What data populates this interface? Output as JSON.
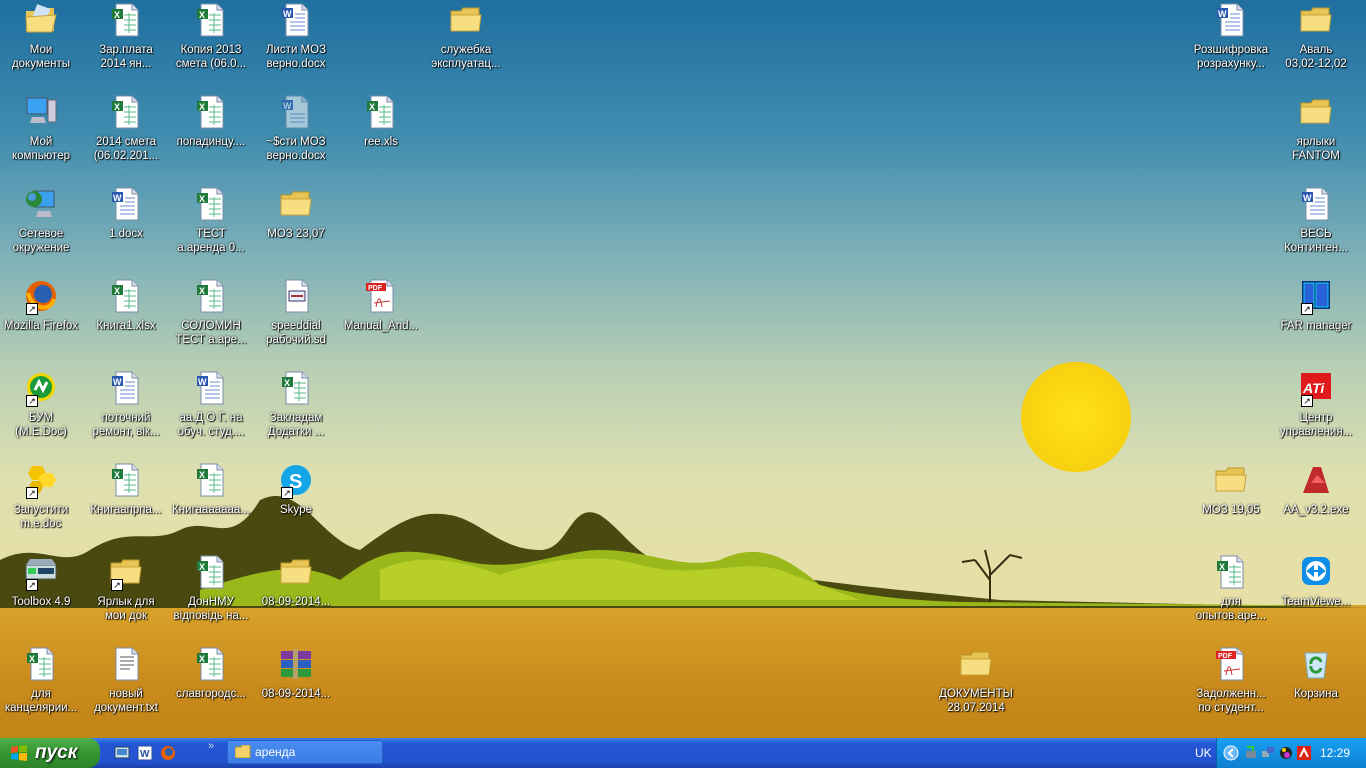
{
  "desktop": {
    "icons": [
      {
        "type": "mydocs",
        "label": "Мои\nдокументы"
      },
      {
        "type": "excel",
        "label": "Зар.плата\n2014 ян..."
      },
      {
        "type": "excel",
        "label": "Копия 2013\nсмета (06.0..."
      },
      {
        "type": "word",
        "label": "Листи МОЗ\nверно.docx"
      },
      {
        "type": "folder",
        "label": "служебка\nэксплуатац..."
      },
      {
        "type": "word",
        "label": "Розшифровка\nрозрахунку..."
      },
      {
        "type": "folder",
        "label": "Аваль\n03,02-12,02"
      },
      {
        "type": "computer",
        "label": "Мой\nкомпьютер"
      },
      {
        "type": "excel",
        "label": "2014 смета\n(06.02.201..."
      },
      {
        "type": "excel",
        "label": "попадинцу...."
      },
      {
        "type": "word-ghost",
        "label": "~$сти МОЗ\nверно.docx"
      },
      {
        "type": "excel",
        "label": "ree.xls"
      },
      {
        "type": "folder",
        "label": "ярлыки\nFANTOM"
      },
      {
        "type": "network",
        "label": "Сетевое\nокружение"
      },
      {
        "type": "word",
        "label": "1.docx"
      },
      {
        "type": "excel",
        "label": "ТЕСТ\nа.аренда 0..."
      },
      {
        "type": "folder",
        "label": "МОЗ 23,07"
      },
      {
        "type": "word",
        "label": "ВЕСЬ\nКонтинген..."
      },
      {
        "type": "firefox",
        "label": "Mozilla Firefox",
        "shortcut": true
      },
      {
        "type": "excel",
        "label": "Книга1.xlsx"
      },
      {
        "type": "excel",
        "label": "СОЛОМИН\nТЕСТ а.аре..."
      },
      {
        "type": "sd",
        "label": "speeddial\nрабочий.sd"
      },
      {
        "type": "pdf",
        "label": "Manual_And..."
      },
      {
        "type": "far",
        "label": "FAR manager",
        "shortcut": true
      },
      {
        "type": "medoc",
        "label": "БУМ\n(M.E.Doc)",
        "shortcut": true
      },
      {
        "type": "word",
        "label": "поточний\nремонт, вік..."
      },
      {
        "type": "word",
        "label": "аа.Д О Г. на\nобуч. студ...."
      },
      {
        "type": "excel",
        "label": "Закладам\nДодатки ..."
      },
      {
        "type": "ati",
        "label": "Центр\nуправления...",
        "shortcut": true
      },
      {
        "type": "medoc-run",
        "label": "Запустити\nm.e.doc",
        "shortcut": true
      },
      {
        "type": "excel",
        "label": "Книгаапрпа..."
      },
      {
        "type": "excel",
        "label": "Книгааааааа..."
      },
      {
        "type": "skype",
        "label": "Skype",
        "shortcut": true
      },
      {
        "type": "folder",
        "label": "МОЗ 19,05"
      },
      {
        "type": "aa",
        "label": "AA_v3.2.exe"
      },
      {
        "type": "toolbox",
        "label": "Toolbox 4.9",
        "shortcut": true
      },
      {
        "type": "folder",
        "label": "Ярлык для\nмои док",
        "shortcut": true
      },
      {
        "type": "excel",
        "label": "ДонНМУ\nвідповідь на..."
      },
      {
        "type": "folder",
        "label": "08-09-2014..."
      },
      {
        "type": "excel",
        "label": "для\nопытов.аре..."
      },
      {
        "type": "teamviewer",
        "label": "TeamViewe..."
      },
      {
        "type": "excel",
        "label": "для\nканцелярии..."
      },
      {
        "type": "txt",
        "label": "новый\nдокумент.txt"
      },
      {
        "type": "excel",
        "label": "славгородс..."
      },
      {
        "type": "rar",
        "label": "08-09-2014..."
      },
      {
        "type": "folder",
        "label": "ДОКУМЕНТЫ\n28.07.2014"
      },
      {
        "type": "pdf",
        "label": "Задолженн...\nпо студент..."
      },
      {
        "type": "recycle",
        "label": "Корзина"
      }
    ]
  },
  "taskbar": {
    "start_label": "пуск",
    "quick_launch": [
      "show-desktop-icon",
      "word-icon",
      "firefox-icon"
    ],
    "overflow": "»",
    "window_button": "аренда",
    "language": "UK",
    "tray_icons": [
      "show-hidden-icon",
      "network-icon",
      "network-connection-icon",
      "antivirus-icon",
      "avira-icon"
    ],
    "clock": "12:29"
  },
  "colors": {
    "taskbar": "#2456d6",
    "start": "#35962f",
    "tray": "#1290e2"
  }
}
